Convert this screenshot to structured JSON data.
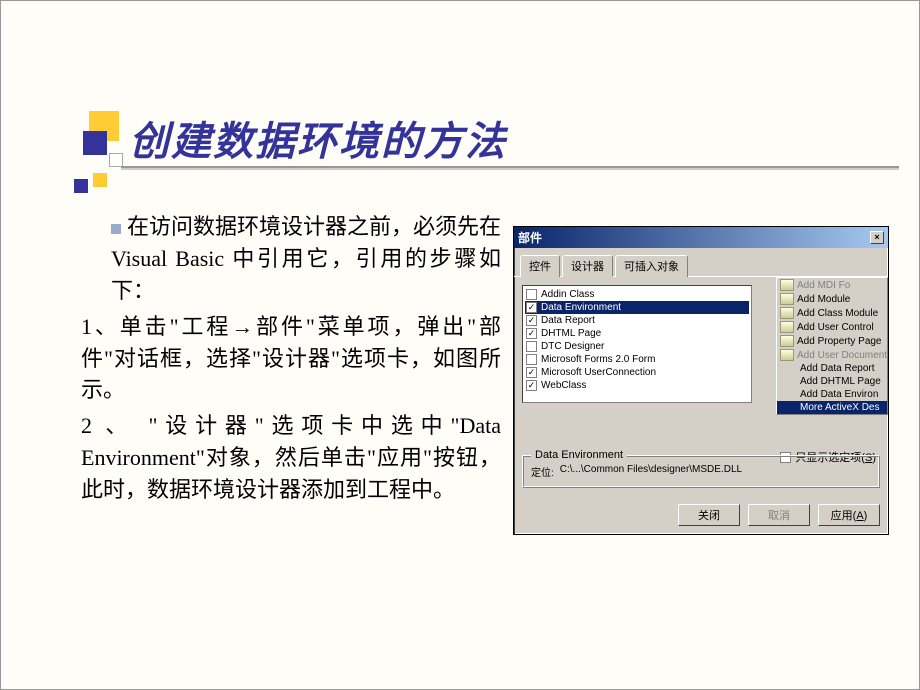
{
  "title": "创建数据环境的方法",
  "body": {
    "intro": "在访问数据环境设计器之前，必须先在 Visual Basic 中引用它，引用的步骤如下：",
    "step1": "1、单击\"工程→部件\"菜单项，弹出\"部件\"对话框，选择\"设计器\"选项卡，如图所示。",
    "step2": "2 、 \"设计器\"选项卡中选中\"Data Environment\"对象，然后单击\"应用\"按钮，此时，数据环境设计器添加到工程中。"
  },
  "dialog": {
    "title": "部件",
    "tabs": [
      "控件",
      "设计器",
      "可插入对象"
    ],
    "active_tab_index": 1,
    "list": [
      {
        "checked": false,
        "label": "Addin Class"
      },
      {
        "checked": true,
        "label": "Data Environment",
        "selected": true
      },
      {
        "checked": true,
        "label": "Data Report"
      },
      {
        "checked": true,
        "label": "DHTML Page"
      },
      {
        "checked": false,
        "label": "DTC Designer"
      },
      {
        "checked": false,
        "label": "Microsoft Forms 2.0 Form"
      },
      {
        "checked": true,
        "label": "Microsoft UserConnection"
      },
      {
        "checked": true,
        "label": "WebClass"
      }
    ],
    "menu": [
      {
        "label": "Add MDI Fo",
        "disabled": true
      },
      {
        "label": "Add Module"
      },
      {
        "label": "Add Class Module"
      },
      {
        "label": "Add User Control"
      },
      {
        "label": "Add Property Page"
      },
      {
        "label": "Add User Document",
        "disabled": true
      },
      {
        "label": "Add Data Report",
        "noicon": true
      },
      {
        "label": "Add DHTML Page",
        "noicon": true
      },
      {
        "label": "Add Data Environ",
        "noicon": true
      },
      {
        "label": "More ActiveX Des",
        "highlight": true,
        "noicon": true
      }
    ],
    "only_selected_label": "只显示选定项(S)",
    "group_title": "Data Environment",
    "location_label": "定位:",
    "location_value": "C:\\...\\Common Files\\designer\\MSDE.DLL",
    "buttons": {
      "close": "关闭",
      "cancel": "取消",
      "apply": "应用(A)"
    }
  }
}
